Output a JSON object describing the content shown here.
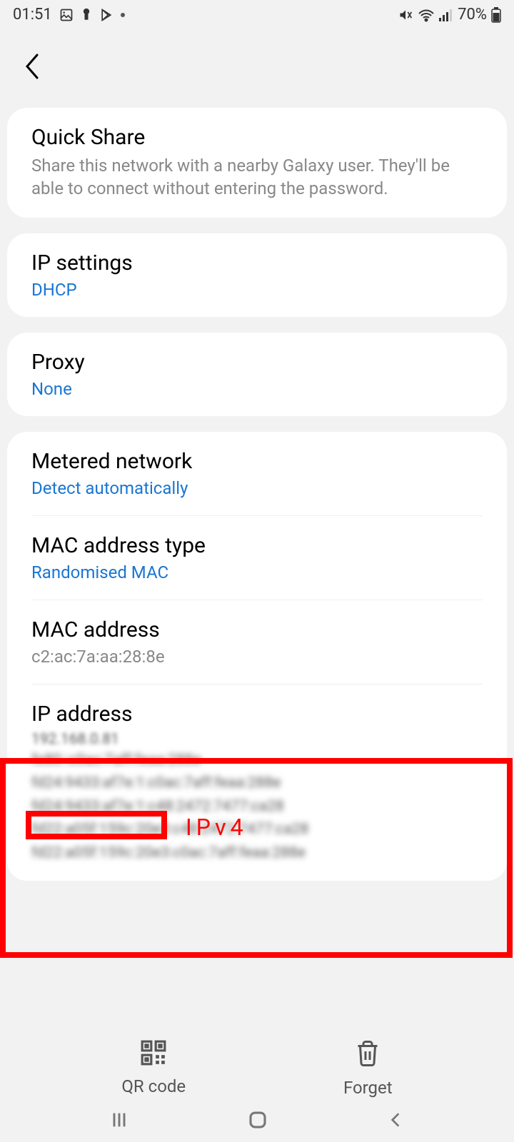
{
  "status_bar": {
    "time": "01:51",
    "battery": "70%"
  },
  "quick_share": {
    "title": "Quick Share",
    "description": "Share this network with a nearby Galaxy user. They'll be able to connect without entering the password."
  },
  "ip_settings": {
    "title": "IP settings",
    "value": "DHCP"
  },
  "proxy": {
    "title": "Proxy",
    "value": "None"
  },
  "metered": {
    "title": "Metered network",
    "value": "Detect automatically"
  },
  "mac_type": {
    "title": "MAC address type",
    "value": "Randomised MAC"
  },
  "mac_address": {
    "title": "MAC address",
    "value": "c2:ac:7a:aa:28:8e"
  },
  "ip_address": {
    "title": "IP address",
    "line1": "192.168.0.81",
    "line2": "fe80::c0ac:7aff:feaa:288e",
    "line3": "fd24:9433:af7e:1:c0ac:7aff:feaa:288e",
    "line4": "fd24:9433:af7e:1:c48:2472:7477:ca28",
    "line5": "fd22:a05f:159c:20e3:c48:2472:7477:ca28",
    "line6": "fd22:a05f:159c:20e3:c0ac:7aff:feaa:288e"
  },
  "annotation": {
    "ipv4_label": "IPv4"
  },
  "actions": {
    "qr_code": "QR code",
    "forget": "Forget"
  }
}
